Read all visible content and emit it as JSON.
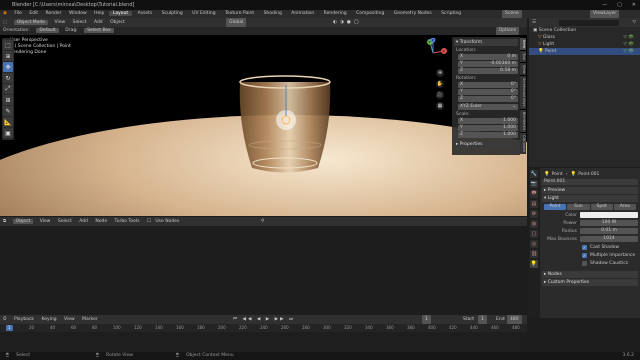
{
  "title_bar": {
    "text": "Blender [C:\\Users\\mircea\\Desktop\\Tutorial.blend]",
    "minimize": "—",
    "maximize": "▢",
    "close": "✕"
  },
  "top_menu": {
    "menus": [
      "File",
      "Edit",
      "Render",
      "Window",
      "Help"
    ],
    "workspaces": [
      "Layout",
      "Assets",
      "Sculpting",
      "UV Editing",
      "Texture Paint",
      "Shading",
      "Animation",
      "Rendering",
      "Compositing",
      "Geometry Nodes",
      "Scripting"
    ],
    "active_workspace": "Layout",
    "scene": "Scene",
    "view_layer": "ViewLayer"
  },
  "viewport_header": {
    "mode": "Object Mode",
    "menus": [
      "View",
      "Select",
      "Add",
      "Object"
    ],
    "orientation": "Global",
    "options": "Options"
  },
  "tool_settings": {
    "orientation_label": "Orientation:",
    "orientation_value": "Default",
    "drag_label": "Drag:",
    "drag_value": "Select Box"
  },
  "viewport_info": {
    "line1": "User Perspective",
    "line2": "(1) Scene Collection | Point",
    "line3": "Rendering Done"
  },
  "gizmo": {
    "x": "X",
    "y": "Y",
    "z": "Z"
  },
  "n_panel": {
    "transform": "Transform",
    "location": "Location:",
    "loc": [
      {
        "axis": "X",
        "value": "0 m"
      },
      {
        "axis": "Y",
        "value": "-0.00360 m"
      },
      {
        "axis": "Z",
        "value": "0.58 m"
      }
    ],
    "rotation": "Rotation:",
    "rot": [
      {
        "axis": "X",
        "value": "0°"
      },
      {
        "axis": "Y",
        "value": "0°"
      },
      {
        "axis": "Z",
        "value": "0°"
      }
    ],
    "rotation_mode": "XYZ Euler",
    "scale": "Scale:",
    "scl": [
      {
        "axis": "X",
        "value": "1.000"
      },
      {
        "axis": "Y",
        "value": "1.000"
      },
      {
        "axis": "Z",
        "value": "1.000"
      }
    ],
    "properties": "Properties",
    "tabs": [
      "Item",
      "Tool",
      "View",
      "Screencast Keys",
      "BlenderKit",
      "CGCookie"
    ]
  },
  "node_header": {
    "type": "Object",
    "menus": [
      "View",
      "Select",
      "Add",
      "Node"
    ],
    "turbo_tools": "Turbo Tools",
    "use_nodes": "Use Nodes"
  },
  "outliner": {
    "root": "Scene Collection",
    "items": [
      {
        "name": "Glass",
        "selected": false
      },
      {
        "name": "Light",
        "selected": false
      },
      {
        "name": "Point",
        "selected": true
      }
    ]
  },
  "properties": {
    "breadcrumb_object": "Point",
    "breadcrumb_data": "Point.001",
    "datablock": "Point.001",
    "preview": "Preview",
    "light": "Light",
    "light_types": [
      "Point",
      "Sun",
      "Spot",
      "Area"
    ],
    "active_light_type": "Point",
    "color_label": "Color",
    "power_label": "Power",
    "power_value": "100 W",
    "radius_label": "Radius",
    "radius_value": "0.01 m",
    "max_bounces_label": "Max Bounces",
    "max_bounces_value": "1024",
    "cast_shadow": "Cast Shadow",
    "multiple_importance": "Multiple Importance",
    "shadow_caustics": "Shadow Caustics",
    "nodes": "Nodes",
    "custom_properties": "Custom Properties"
  },
  "timeline": {
    "menus": [
      "Playback",
      "Keying",
      "View",
      "Marker"
    ],
    "current_frame": "1",
    "start_label": "Start",
    "start": "1",
    "end_label": "End",
    "end": "480",
    "ticks": [
      "1",
      "20",
      "40",
      "60",
      "80",
      "100",
      "120",
      "140",
      "160",
      "180",
      "200",
      "220",
      "240",
      "260",
      "280",
      "300",
      "320",
      "340",
      "360",
      "380",
      "400",
      "420",
      "440",
      "460",
      "480"
    ]
  },
  "status_bar": {
    "select": "Select",
    "rotate": "Rotate View",
    "context": "Object Context Menu",
    "version": "3.6.2"
  },
  "colors": {
    "accent": "#4772b3",
    "selected_row": "#334d80",
    "collection_green": "#7fc05f",
    "light_orange": "#f0a040"
  }
}
